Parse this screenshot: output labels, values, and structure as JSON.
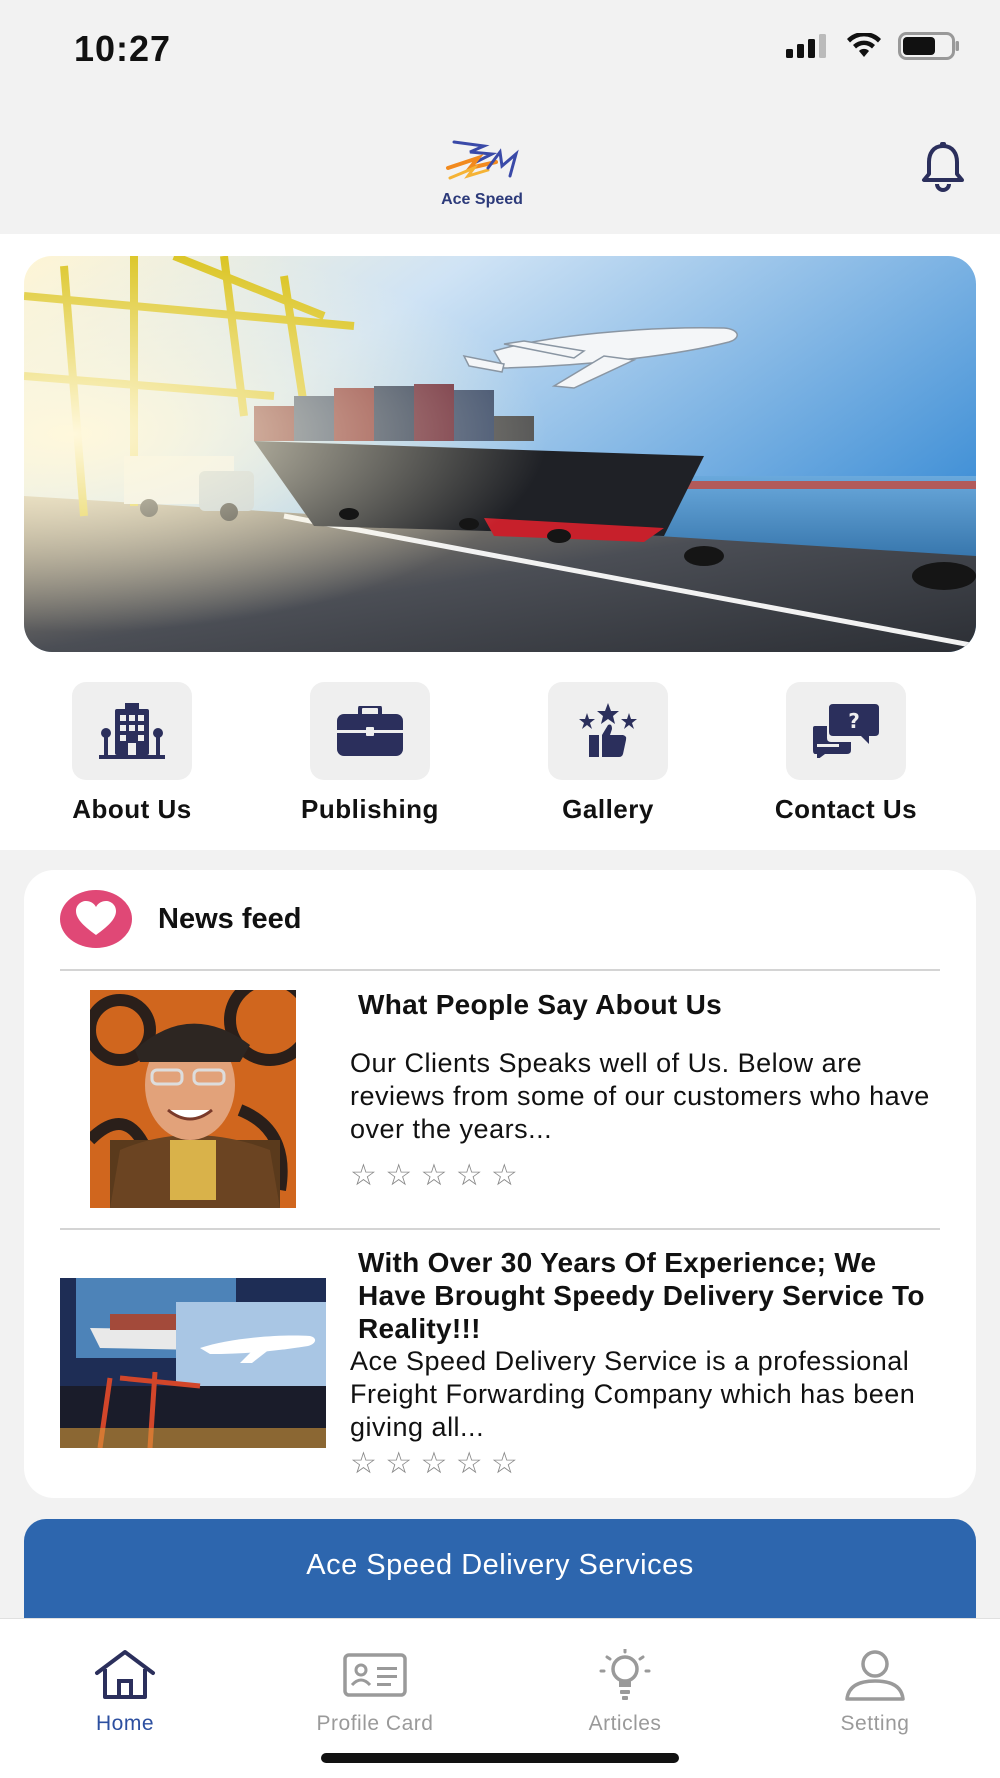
{
  "status_bar": {
    "time": "10:27"
  },
  "header": {
    "logo_text": "Ace Speed"
  },
  "quick_links": [
    {
      "label": "About Us",
      "icon": "building-icon"
    },
    {
      "label": "Publishing",
      "icon": "briefcase-icon"
    },
    {
      "label": "Gallery",
      "icon": "thumbs-up-stars-icon"
    },
    {
      "label": "Contact Us",
      "icon": "chat-question-icon"
    }
  ],
  "news_feed": {
    "title": "News feed",
    "articles": [
      {
        "title": "What People Say About Us",
        "body": " Our Clients Speaks well of Us. Below are reviews from some of our customers who have over the years...",
        "stars": "☆ ☆ ☆ ☆ ☆"
      },
      {
        "title": "With Over 30 Years Of Experience; We Have Brought Speedy Delivery Service To Reality!!!",
        "body": " Ace Speed Delivery Service is a professional Freight Forwarding Company which has been giving all...",
        "stars": "☆ ☆ ☆ ☆ ☆"
      }
    ]
  },
  "cta": {
    "label": "Ace Speed Delivery Services"
  },
  "tabs": [
    {
      "label": "Home",
      "icon": "home-icon",
      "active": true
    },
    {
      "label": "Profile Card",
      "icon": "id-card-icon",
      "active": false
    },
    {
      "label": "Articles",
      "icon": "lightbulb-icon",
      "active": false
    },
    {
      "label": "Setting",
      "icon": "user-icon",
      "active": false
    }
  ],
  "colors": {
    "accent": "#2d66ae",
    "icon_navy": "#2b2f5c",
    "heart": "#e04876",
    "tab_active": "#2c4fa0"
  }
}
